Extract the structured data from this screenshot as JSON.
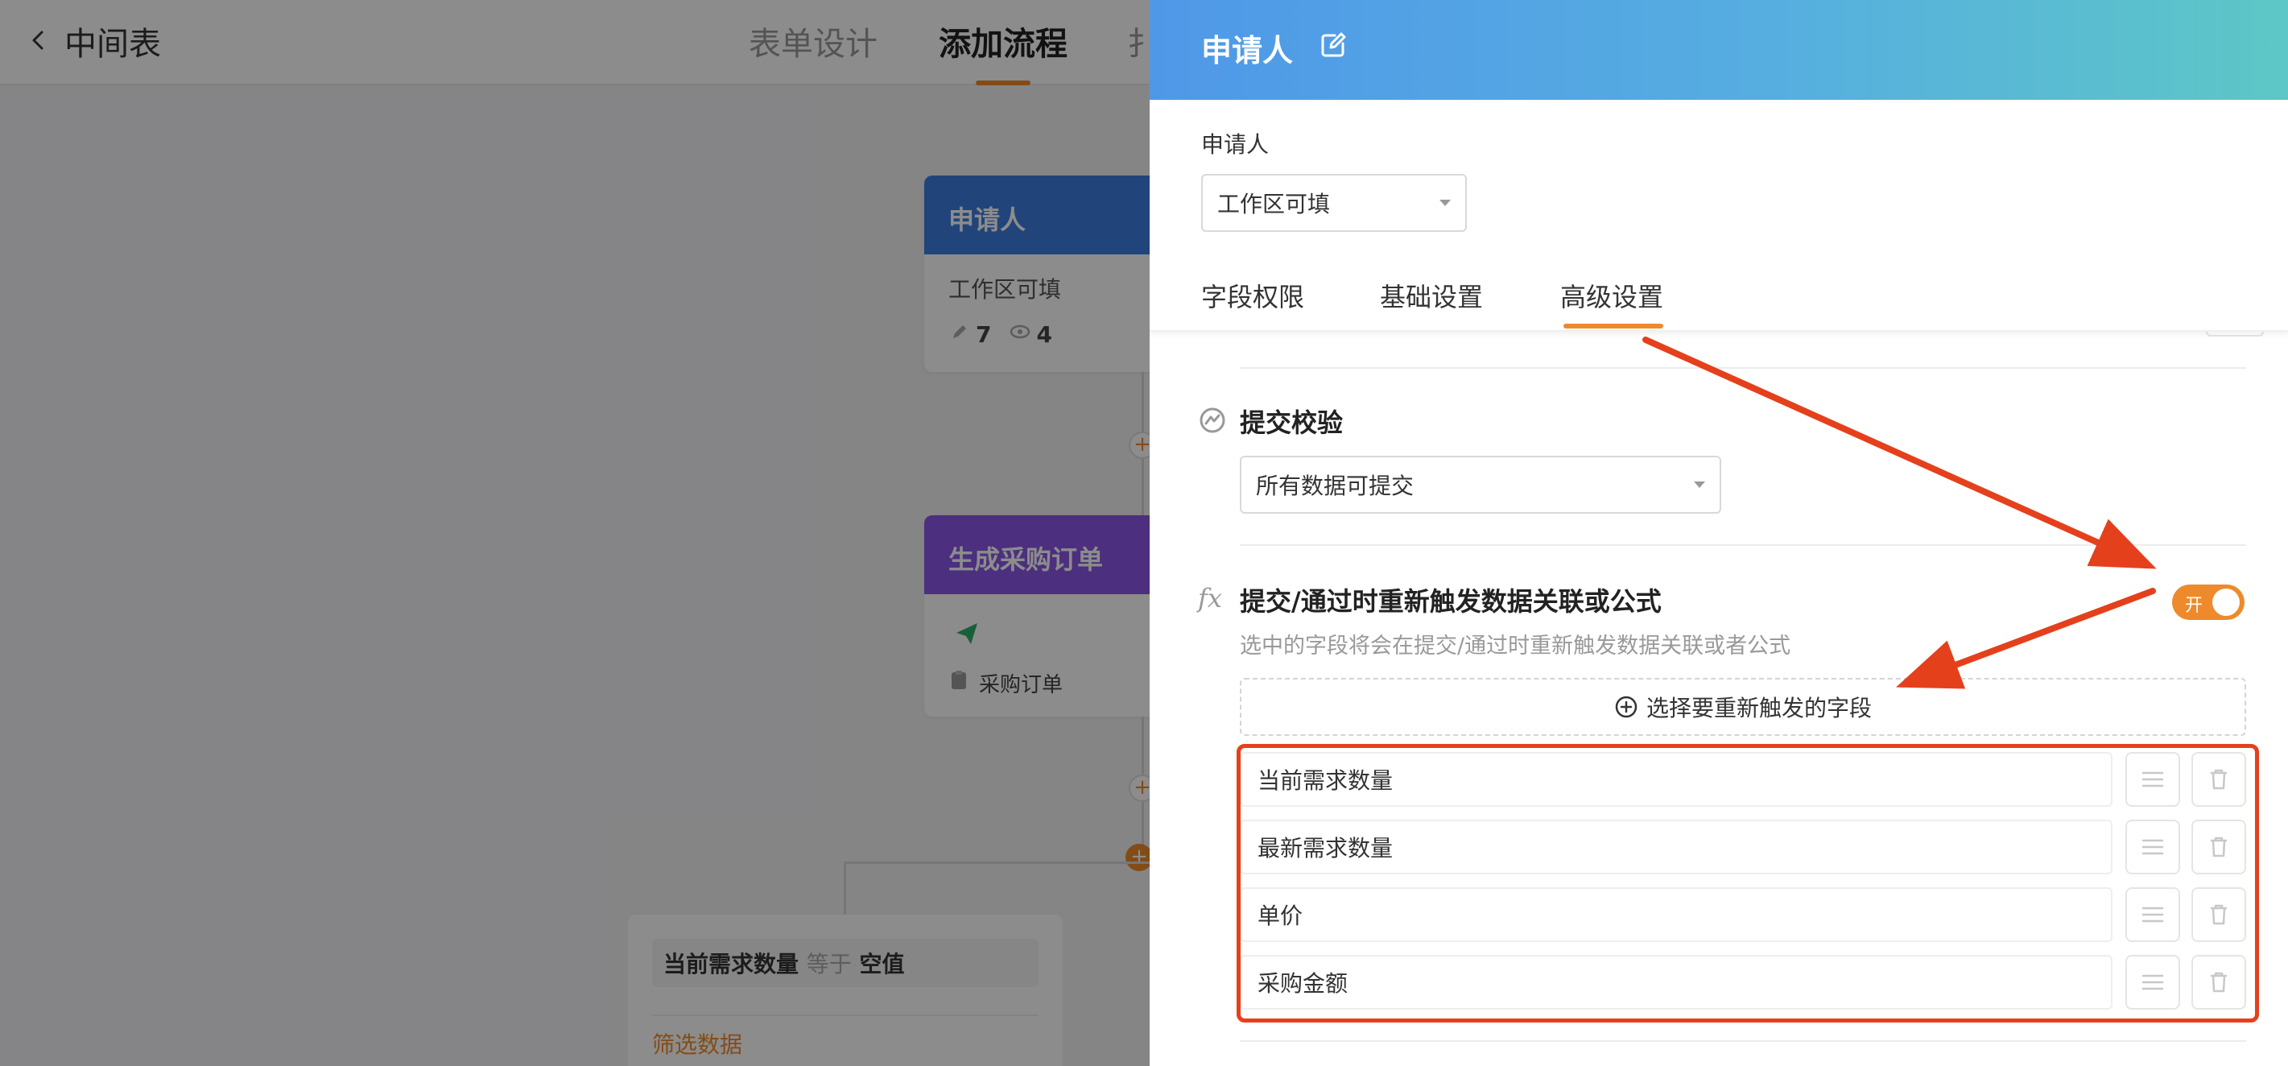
{
  "app": {
    "title": "中间表",
    "tabs": [
      {
        "label": "表单设计",
        "active": false
      },
      {
        "label": "添加流程",
        "active": true
      },
      {
        "label": "扌",
        "active": false
      }
    ]
  },
  "canvas": {
    "node_applicant": {
      "title": "申请人",
      "line": "工作区可填",
      "edit_count": "7",
      "view_count": "4"
    },
    "node_order": {
      "title": "生成采购订单",
      "item": "采购订单"
    },
    "plus": "+",
    "filter": {
      "field": "当前需求数量",
      "operator": "等于",
      "value": "空值",
      "link": "筛选数据"
    }
  },
  "drawer": {
    "title": "申请人",
    "role_label": "申请人",
    "role_select": "工作区可填",
    "tabs": [
      {
        "label": "字段权限",
        "active": false
      },
      {
        "label": "基础设置",
        "active": false
      },
      {
        "label": "高级设置",
        "active": true
      }
    ],
    "submit_validation": {
      "title": "提交校验",
      "select_value": "所有数据可提交"
    },
    "retrigger": {
      "title": "提交/通过时重新触发数据关联或公式",
      "desc": "选中的字段将会在提交/通过时重新触发数据关联或者公式",
      "toggle_label": "开",
      "toggle_on": true,
      "add_button": "选择要重新触发的字段",
      "fields": [
        "当前需求数量",
        "最新需求数量",
        "单价",
        "采购金额"
      ]
    }
  },
  "colors": {
    "accent": "#ee8a2b",
    "annotation": "#e5401c",
    "header_start": "#4f98e8",
    "header_end": "#5dc7c6",
    "node_applicant": "#3c7fe0",
    "node_order": "#8a57e6"
  },
  "icons": [
    "back-arrow-icon",
    "edit-icon",
    "pencil-icon",
    "eye-icon",
    "send-icon",
    "clipboard-icon",
    "validation-icon",
    "fx-icon",
    "plus-circle-icon",
    "drag-handle-icon",
    "trash-icon"
  ]
}
